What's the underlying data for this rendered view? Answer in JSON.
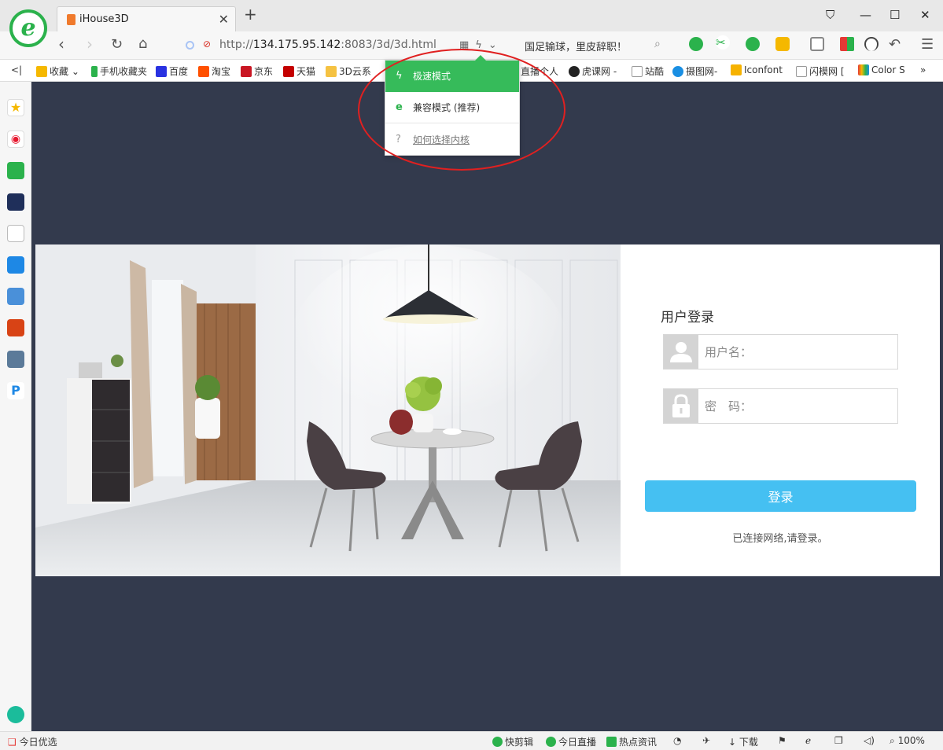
{
  "tab": {
    "title": "iHouse3D"
  },
  "address": {
    "host": "134.175.95.142",
    "rest": ":8083/3d/3d.html",
    "prefix": "http://",
    "news": "国足输球，里皮辞职！"
  },
  "bookmarks": [
    {
      "label": "收藏",
      "color": "#f5b800"
    },
    {
      "label": "手机收藏夹",
      "color": "#2bb24c"
    },
    {
      "label": "百度",
      "color": "#2932e1"
    },
    {
      "label": "淘宝",
      "color": "#ff5000"
    },
    {
      "label": "京东",
      "color": "#c91623"
    },
    {
      "label": "天猫",
      "color": "#c40000"
    },
    {
      "label": "3D云系",
      "color": "#f5c242"
    },
    {
      "label": "直播个人",
      "color": "#888888"
    },
    {
      "label": "虎课网 -",
      "color": "#222222"
    },
    {
      "label": "站酷",
      "color": "#999999"
    },
    {
      "label": "摄图网-",
      "color": "#1a8fe3"
    },
    {
      "label": "Iconfont",
      "color": "#f6b200"
    },
    {
      "label": "闪模网 [",
      "color": "#999999"
    },
    {
      "label": "Color S",
      "color": "#e53935"
    }
  ],
  "dropdown": {
    "fast": "极速模式",
    "compat": "兼容模式 (推荐)",
    "help": "如何选择内核"
  },
  "login": {
    "title": "用户登录",
    "username_placeholder": "用户名：",
    "password_placeholder": "密　码：",
    "button": "登录",
    "status": "已连接网络,请登录。"
  },
  "statusbar": {
    "left": "今日优选",
    "items": [
      "快剪辑",
      "今日直播",
      "热点资讯"
    ],
    "download": "下载",
    "zoom": "100%"
  },
  "colors": {
    "page_bg": "#333a4d",
    "login_button": "#45c0f2",
    "fast_mode": "#36bb5a",
    "annotation": "#e02020"
  }
}
